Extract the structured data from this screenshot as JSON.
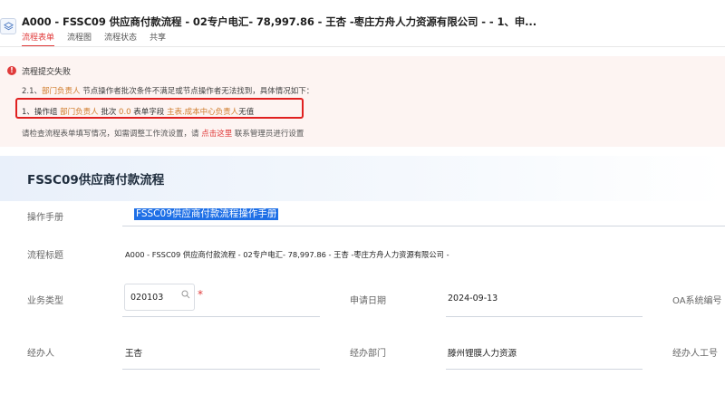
{
  "header": {
    "title": "A000 -  FSSC09 供应商付款流程 - 02专户电汇- 78,997.86  - 王杏 -枣庄方舟人力资源有限公司 -    - 1、申...",
    "tabs": [
      {
        "label": "流程表单",
        "active": true
      },
      {
        "label": "流程图",
        "active": false
      },
      {
        "label": "流程状态",
        "active": false
      },
      {
        "label": "共享",
        "active": false
      }
    ]
  },
  "error": {
    "title": "流程提交失败",
    "line1_prefix": "2.1、",
    "line1_highlight": "部门负责人",
    "line1_rest": " 节点操作者批次条件不满足或节点操作者无法找到，具体情况如下：",
    "line2": {
      "p1": "1、操作组 ",
      "h1": "部门负责人",
      "p2": "  批次 ",
      "h2": "0.0",
      "p3": "   表单字段  ",
      "h3": "主表.成本中心负责人",
      "p4": "无值"
    },
    "line3_prefix": "请检查流程表单填写情况，如需调整工作流设置，请 ",
    "line3_link": "点击这里",
    "line3_suffix": " 联系管理员进行设置"
  },
  "form": {
    "title": "FSSC09供应商付款流程",
    "manual_label": "操作手册",
    "manual_link": "FSSC09供应商付款流程操作手册",
    "flow_title_label": "流程标题",
    "flow_title_value": "A000 - FSSC09 供应商付款流程 - 02专户电汇- 78,997.86 - 王杏 -枣庄方舟人力资源有限公司 -",
    "biz_type_label": "业务类型",
    "biz_type_value": "020103",
    "required_mark": "*",
    "apply_date_label": "申请日期",
    "apply_date_value": "2024-09-13",
    "oa_no_label": "OA系统编号",
    "handler_label": "经办人",
    "handler_value": "王杏",
    "dept_label": "经办部门",
    "dept_value": "滕州锂膜人力资源",
    "emp_no_label": "经办人工号"
  },
  "colors": {
    "accent_red": "#e03b3b",
    "highlight_orange": "#d07c2c",
    "link_blue": "#1e6fe6",
    "error_bg": "#fdf4f2"
  }
}
